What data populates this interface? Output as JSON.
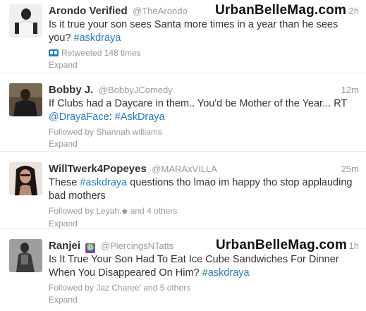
{
  "tweets": [
    {
      "fullname": "Arondo Verified",
      "username": "@TheArondo",
      "time": "2h",
      "watermark": "UrbanBelleMag.com",
      "text_1": "Is it true your son sees Santa more times in a year than he sees you? ",
      "hashtag": "#askdraya",
      "context": "Retweeted 148 times",
      "expand": "Expand"
    },
    {
      "fullname": "Bobby J.",
      "username": "@BobbyJComedy",
      "time": "12m",
      "text_1": "If Clubs had a Daycare in them.. You'd be Mother of the Year... RT ",
      "mention": "@DrayaFace",
      "text_2": ": ",
      "hashtag": "#AskDraya",
      "context": "Followed by Shannah williams",
      "expand": "Expand"
    },
    {
      "fullname": "WillTwerk4Popeyes",
      "username": "@MARAxVILLA",
      "time": "25m",
      "text_1": "These ",
      "hashtag": "#askdraya",
      "text_2": " questions tho lmao im happy tho stop applauding bad mothers",
      "context_1": "Followed by Leyah.",
      "crown": "♚",
      "context_2": " and 4 others",
      "expand": "Expand"
    },
    {
      "fullname": "Ranjei",
      "badge": "♎",
      "username": "@PiercingsNTatts",
      "time": "1h",
      "watermark": "UrbanBelleMag.com",
      "text_1": "Is It True Your Son Had To Eat Ice Cube Sandwiches For Dinner When You Disappeared On Him? ",
      "hashtag": "#askdraya",
      "context": "Followed by Jaz Charee' and 5 others",
      "expand": "Expand"
    }
  ],
  "colors": {
    "link": "#2b7bb9",
    "muted": "#999999",
    "text": "#333333",
    "divider": "#e8e8e8"
  }
}
